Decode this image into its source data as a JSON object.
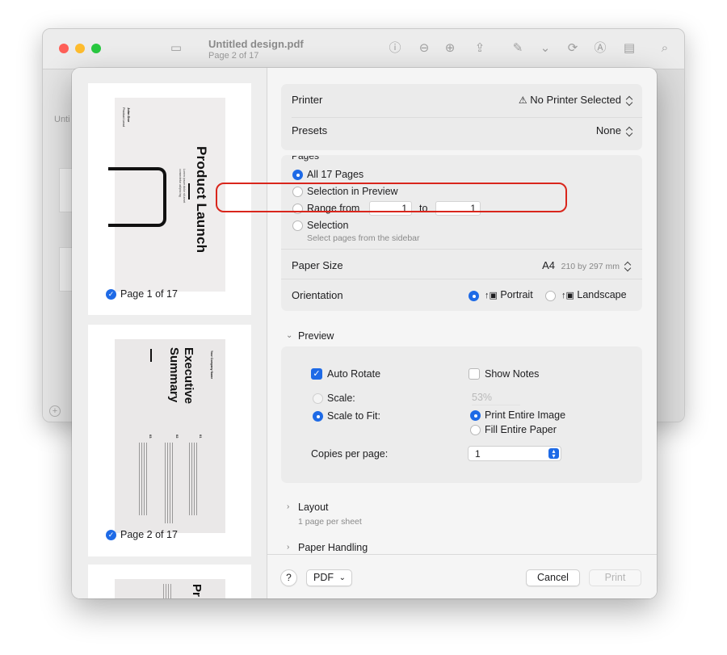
{
  "window": {
    "title": "Untitled design.pdf",
    "subtitle": "Page 2 of 17",
    "sidebar_text": "Unti"
  },
  "thumbnails": [
    {
      "label": "Page 1 of 17",
      "selected": true,
      "title": "Product Launch",
      "top_small": "John Doe",
      "top_small2": "Product Lead"
    },
    {
      "label": "Page 2 of 17",
      "selected": true,
      "title_line1": "Executive",
      "title_line2": "Summary",
      "small_header": "Your Company Name",
      "num1": "01",
      "num2": "02",
      "num3": "03"
    },
    {
      "label": "",
      "selected": false,
      "title": "Pr"
    }
  ],
  "printer": {
    "label": "Printer",
    "value": "No Printer Selected"
  },
  "presets": {
    "label": "Presets",
    "value": "None"
  },
  "pages": {
    "section_label": "Pages",
    "options": {
      "all": "All 17 Pages",
      "selection_preview": "Selection in Preview",
      "range": "Range from",
      "range_to": "to",
      "range_from_value": "1",
      "range_to_value": "1",
      "selection": "Selection",
      "selection_hint": "Select pages from the sidebar"
    },
    "selected": "all"
  },
  "paper_size": {
    "label": "Paper Size",
    "value": "A4",
    "detail": "210 by 297 mm"
  },
  "orientation": {
    "label": "Orientation",
    "portrait": "Portrait",
    "landscape": "Landscape",
    "selected": "portrait"
  },
  "preview": {
    "header": "Preview",
    "auto_rotate": "Auto Rotate",
    "auto_rotate_checked": true,
    "show_notes": "Show Notes",
    "show_notes_checked": false,
    "scale_label": "Scale:",
    "scale_value": "53%",
    "scale_to_fit": "Scale to Fit:",
    "print_entire_image": "Print Entire Image",
    "fill_entire_paper": "Fill Entire Paper",
    "copies_label": "Copies per page:",
    "copies_value": "1"
  },
  "layout": {
    "header": "Layout",
    "summary": "1 page per sheet"
  },
  "paper_handling": {
    "header": "Paper Handling"
  },
  "footer": {
    "help": "?",
    "pdf": "PDF",
    "cancel": "Cancel",
    "print": "Print"
  },
  "colors": {
    "accent": "#1e6ae6",
    "highlight": "#d9261c"
  }
}
